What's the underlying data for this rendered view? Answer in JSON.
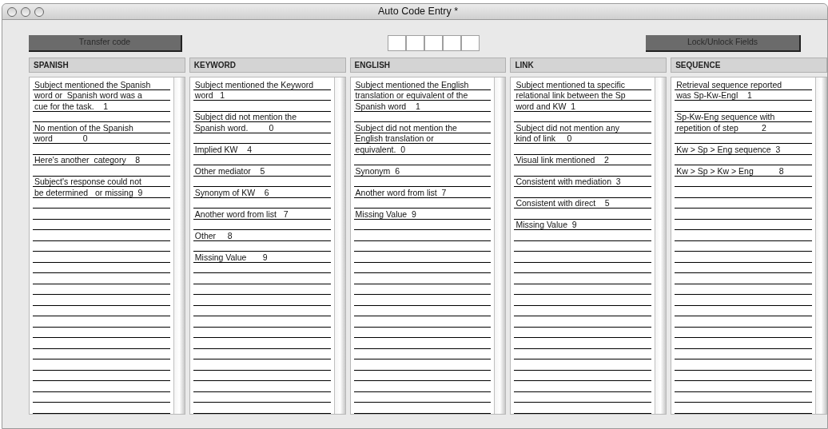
{
  "window": {
    "title": "Auto Code Entry *"
  },
  "toolbar": {
    "left_button": "Transfer code",
    "right_button": "Lock/Unlock Fields"
  },
  "columns": [
    {
      "header": "SPANISH",
      "entries": [
        {
          "lines": [
            "Subject mentioned the Spanish",
            "word or  Spanish word was a",
            "cue for the task.    1"
          ]
        },
        {
          "lines": [
            "No mention of the Spanish",
            "word             0"
          ]
        },
        {
          "lines": [
            "Here's another  category    8"
          ]
        },
        {
          "lines": [
            "Subject's response could not",
            "be determined   or missing  9"
          ]
        }
      ]
    },
    {
      "header": "KEYWORD",
      "entries": [
        {
          "lines": [
            "Subject mentioned the Keyword",
            "word   1"
          ]
        },
        {
          "lines": [
            "Subject did not mention the",
            "Spanish word.         0"
          ]
        },
        {
          "lines": [
            "Implied KW    4"
          ]
        },
        {
          "lines": [
            "Other mediator    5"
          ]
        },
        {
          "lines": [
            "Synonym of KW    6"
          ]
        },
        {
          "lines": [
            "Another word from list   7"
          ]
        },
        {
          "lines": [
            "Other     8"
          ]
        },
        {
          "lines": [
            "Missing Value       9"
          ]
        }
      ]
    },
    {
      "header": "ENGLISH",
      "entries": [
        {
          "lines": [
            "Subject mentioned the English",
            "translation or equivalent of the",
            "Spanish word    1"
          ]
        },
        {
          "lines": [
            "Subject did not mention the",
            "English translation or",
            "equivalent.  0"
          ]
        },
        {
          "lines": [
            "Synonym  6"
          ]
        },
        {
          "lines": [
            "Another word from list  7"
          ]
        },
        {
          "lines": [
            "Missing Value  9"
          ]
        }
      ]
    },
    {
      "header": "LINK",
      "entries": [
        {
          "lines": [
            "Subject mentioned ta specific",
            "relational link between the Sp",
            "word and KW  1"
          ]
        },
        {
          "lines": [
            "Subject did not mention any",
            "kind of link     0"
          ]
        },
        {
          "lines": [
            "Visual link mentioned    2"
          ]
        },
        {
          "lines": [
            "Consistent with mediation  3"
          ]
        },
        {
          "lines": [
            "Consistent with direct    5"
          ]
        },
        {
          "lines": [
            "Missing Value  9"
          ]
        }
      ]
    },
    {
      "header": "SEQUENCE",
      "entries": [
        {
          "lines": [
            "Retrieval sequence reported",
            "was Sp-Kw-Engl    1"
          ]
        },
        {
          "lines": [
            "Sp-Kw-Eng sequence with",
            "repetition of step          2"
          ]
        },
        {
          "lines": [
            "Kw > Sp > Eng sequence  3"
          ]
        },
        {
          "lines": [
            "Kw > Sp > Kw > Eng           8"
          ]
        }
      ]
    }
  ]
}
